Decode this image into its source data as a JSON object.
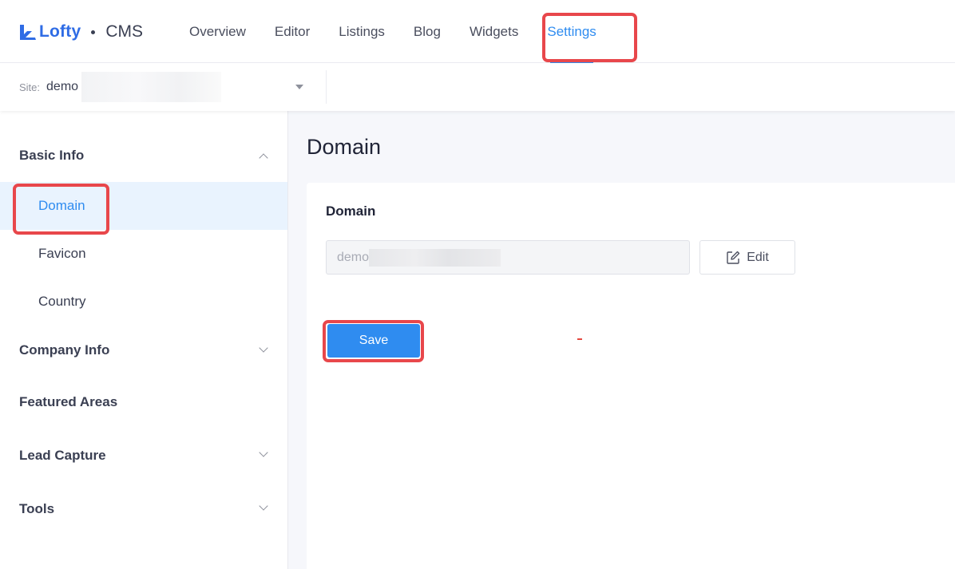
{
  "brand": {
    "name": "Lofty",
    "product": "CMS",
    "accent": "#2f6ce5"
  },
  "nav": {
    "items": [
      {
        "label": "Overview"
      },
      {
        "label": "Editor"
      },
      {
        "label": "Listings"
      },
      {
        "label": "Blog"
      },
      {
        "label": "Widgets"
      },
      {
        "label": "Settings",
        "active": true
      }
    ]
  },
  "site": {
    "label": "Site:",
    "value": "demo"
  },
  "sidebar": {
    "basic_info": "Basic Info",
    "basic_items": [
      {
        "label": "Domain",
        "active": true
      },
      {
        "label": "Favicon"
      },
      {
        "label": "Country"
      }
    ],
    "company_info": "Company Info",
    "featured_areas": "Featured Areas",
    "lead_capture": "Lead Capture",
    "tools": "Tools"
  },
  "main": {
    "page_title": "Domain",
    "card_title": "Domain",
    "domain_value": "demo",
    "edit_label": "Edit",
    "save_label": "Save"
  },
  "colors": {
    "primary": "#2f8cf0",
    "highlight": "#e8474b"
  }
}
